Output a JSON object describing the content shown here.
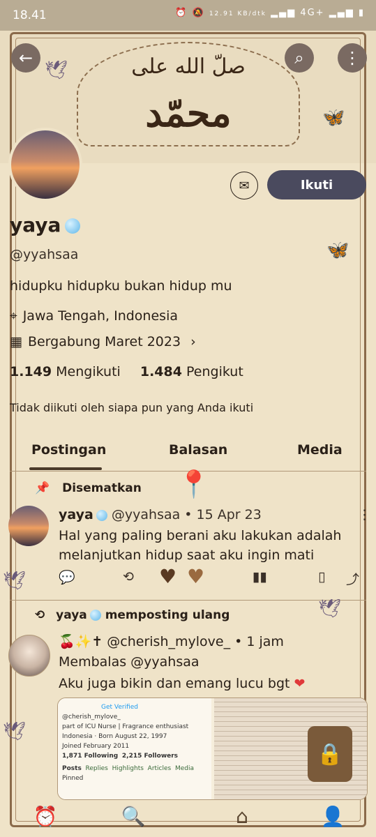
{
  "status_bar": {
    "time": "18.41",
    "speed": "12.91 KB/dtk",
    "network": "4G+"
  },
  "header": {
    "arabic_top": "صلّ الله على",
    "arabic_main": "محمّد"
  },
  "profile": {
    "follow_label": "Ikuti",
    "name": "yaya",
    "handle": "@yyahsaa",
    "bio": "hidupku hidupku bukan hidup mu",
    "location": "Jawa Tengah, Indonesia",
    "joined": "Bergabung Maret 2023",
    "following_count": "1.149",
    "following_label": "Mengikuti",
    "followers_count": "1.484",
    "followers_label": "Pengikut",
    "not_followed": "Tidak diikuti oleh siapa pun yang Anda ikuti"
  },
  "tabs": [
    "Postingan",
    "Balasan",
    "Media"
  ],
  "pinned_post": {
    "pinned_label": "Disematkan",
    "name": "yaya",
    "handle_date": "@yyahsaa • 15 Apr 23",
    "text_line1": "Hal yang paling berani aku lakukan adalah",
    "text_line2": "melanjutkan hidup saat aku ingin mati"
  },
  "repost": {
    "repost_label": "yaya",
    "repost_suffix": "memposting ulang",
    "handle_time": "@cherish_mylove_ • 1 jam",
    "reply_to": "Membalas @yyahsaa",
    "text": "Aku juga bikin dan emang lucu bgt"
  },
  "embed": {
    "get_verified": "Get Verified",
    "handle": "@cherish_mylove_",
    "bio": "part of ICU Nurse | Fragrance enthusiast",
    "location": "Indonesia",
    "born": "Born August 22, 1997",
    "joined": "Joined February 2011",
    "following": "1,871 Following",
    "followers": "2,215 Followers",
    "tabs": [
      "Posts",
      "Replies",
      "Highlights",
      "Articles",
      "Media"
    ],
    "pinned": "Pinned"
  },
  "colors": {
    "follow_bg": "#4a4a5e",
    "frame": "#8a6a4a",
    "paper": "#efe3c8",
    "heart": "#e03a3a"
  }
}
